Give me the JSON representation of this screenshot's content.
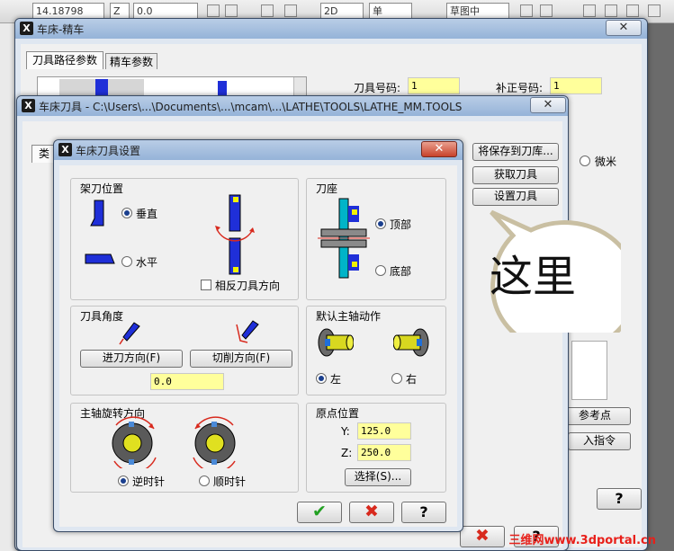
{
  "toolbar": {
    "field1": "14.18798",
    "field2": "Z",
    "field3": "0.0",
    "field4": "2D",
    "field5": "单",
    "field6": "草图中"
  },
  "back_window": {
    "title": "车床-精车",
    "tabs": [
      "刀具路径参数",
      "精车参数"
    ],
    "tool_number_label": "刀具号码:",
    "tool_number_value": "1",
    "offset_number_label": "补正号码:",
    "offset_number_value": "1",
    "micron_label": "微米",
    "reference_point_button": "参考点",
    "insert_command_button": "入指令"
  },
  "middle_window": {
    "title": "车床刀具 - C:\\Users\\...\\Documents\\...\\mcam\\...\\LATHE\\TOOLS\\LATHE_MM.TOOLS",
    "side_tab_label": "类",
    "save_to_library_button": "将保存到刀库...",
    "get_tool_button": "获取刀具",
    "set_tool_button": "设置刀具"
  },
  "dialog": {
    "title": "车床刀具设置",
    "mount_group": {
      "title": "架刀位置",
      "vertical_label": "垂直",
      "horizontal_label": "水平",
      "reverse_label": "相反刀具方向"
    },
    "turret_group": {
      "title": "刀座",
      "top_label": "顶部",
      "bottom_label": "底部"
    },
    "angle_group": {
      "title": "刀具角度",
      "feed_button": "进刀方向(F)",
      "cut_button": "切削方向(F)",
      "angle_value": "0.0"
    },
    "spindle_action_group": {
      "title": "默认主轴动作",
      "left_label": "左",
      "right_label": "右"
    },
    "rotation_group": {
      "title": "主轴旋转方向",
      "ccw_label": "逆时针",
      "cw_label": "顺时针"
    },
    "origin_group": {
      "title": "原点位置",
      "y_label": "Y:",
      "y_value": "125.0",
      "z_label": "Z:",
      "z_value": "250.0",
      "select_button": "选择(S)..."
    },
    "ok_symbol": "✔",
    "cancel_symbol": "✖",
    "help_symbol": "?"
  },
  "callout": {
    "text": "这里"
  },
  "watermark": "三维网www.3dportal.cn",
  "colors": {
    "yellow_field": "#ffff9b",
    "tool_blue": "#1f2fd8",
    "ok_green": "#22a022",
    "cancel_red": "#d82a1e"
  }
}
